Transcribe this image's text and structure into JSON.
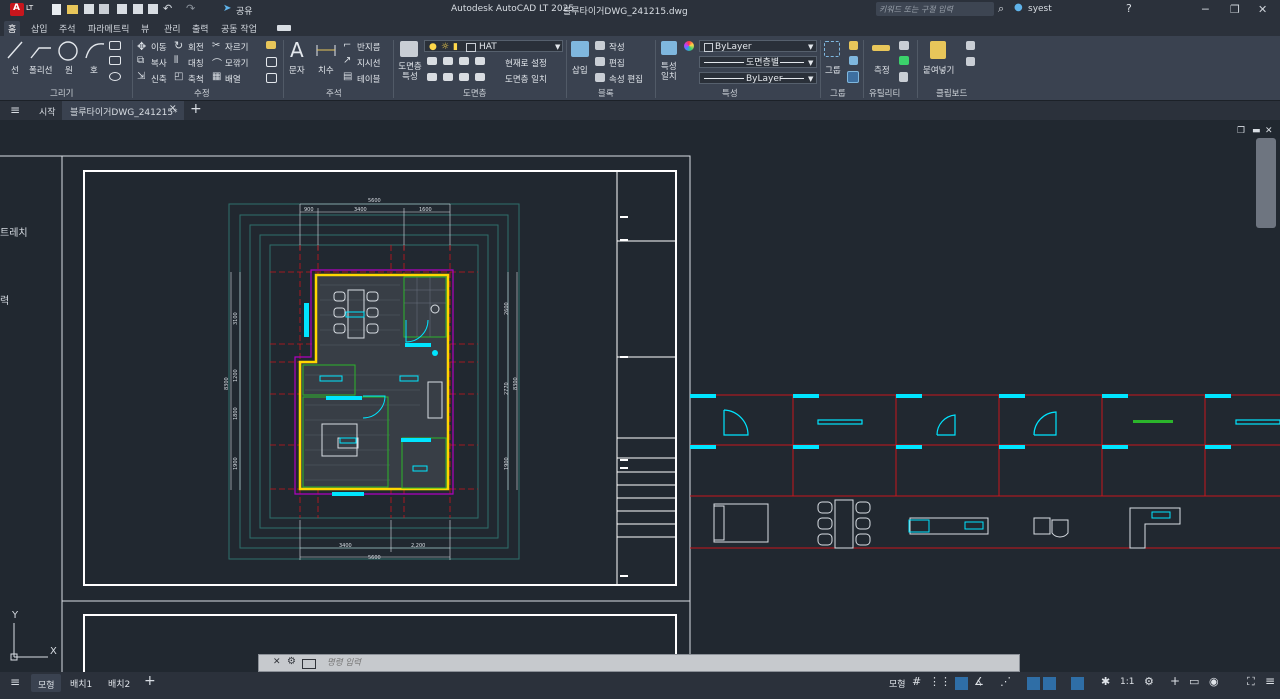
{
  "titlebar": {
    "app_badge": "A",
    "app_badge_sub": "LT",
    "share_label": "공유",
    "app_title": "Autodesk AutoCAD LT 2025",
    "doc_title": "블루타이거DWG_241215.dwg",
    "search_placeholder": "키워드 또는 구절 입력",
    "user": "syest"
  },
  "ribbon_tabs": [
    "홈",
    "삽입",
    "주석",
    "파라메트릭",
    "뷰",
    "관리",
    "출력",
    "공동 작업"
  ],
  "ribbon": {
    "draw": {
      "line": "선",
      "polyline": "폴리선",
      "circle": "원",
      "arc": "호",
      "panel": "그리기"
    },
    "modify": {
      "move": "이동",
      "rotate": "회전",
      "trim": "자르기",
      "copy": "복사",
      "mirror": "대칭",
      "fillet": "모깎기",
      "stretch": "신축",
      "scale": "축척",
      "array": "배열",
      "panel": "수정"
    },
    "annotation": {
      "text": "문자",
      "dimension": "치수",
      "leader": "지시선",
      "table": "테이블",
      "cloud": "반지름",
      "panel": "주석"
    },
    "layers": {
      "properties": "도면층 특성",
      "current_layer": "HAT",
      "make_current": "현재로 설정",
      "match": "도면층 일치",
      "panel": "도면층"
    },
    "block": {
      "insert": "삽입",
      "create": "작성",
      "edit": "편집",
      "edit_attr": "속성 편집",
      "panel": "블록"
    },
    "properties": {
      "match": "특성 일치",
      "color": "ByLayer",
      "linetype": "도면층별",
      "lineweight": "ByLayer",
      "panel": "특성"
    },
    "groups": {
      "group": "그룹",
      "panel": "그룹"
    },
    "utilities": {
      "measure": "측정",
      "panel": "유틸리티"
    },
    "clipboard": {
      "paste": "붙여넣기",
      "panel": "클립보드"
    }
  },
  "file_tabs": {
    "start": "시작",
    "active_doc": "블루타이거DWG_241215*"
  },
  "canvas": {
    "left_labels": [
      "트레치",
      "력"
    ],
    "axis_x": "X",
    "axis_y": "Y",
    "dims": {
      "top_total": "5600",
      "top_a": "900",
      "top_b": "3400",
      "top_c": "1600",
      "bottom_a": "3400",
      "bottom_b": "2,200",
      "bottom_total": "5600",
      "left_a": "3100",
      "left_b": "1200",
      "left_c": "1800",
      "left_d": "1900",
      "left_total": "8300",
      "right_a": "2600",
      "right_b": "2770",
      "right_c": "1900",
      "right_total": "8300"
    }
  },
  "command_line": {
    "placeholder": "명령 입력"
  },
  "statusbar": {
    "tabs": [
      "모형",
      "배치1",
      "배치2"
    ],
    "model_label": "모형",
    "scale": "1:1"
  },
  "colors": {
    "accent": "#0696d7",
    "cad_red": "#c8161d",
    "cad_cyan": "#00e5ff",
    "cad_yellow": "#ffd700",
    "cad_green": "#2bb52b",
    "cad_magenta": "#b000c0"
  }
}
